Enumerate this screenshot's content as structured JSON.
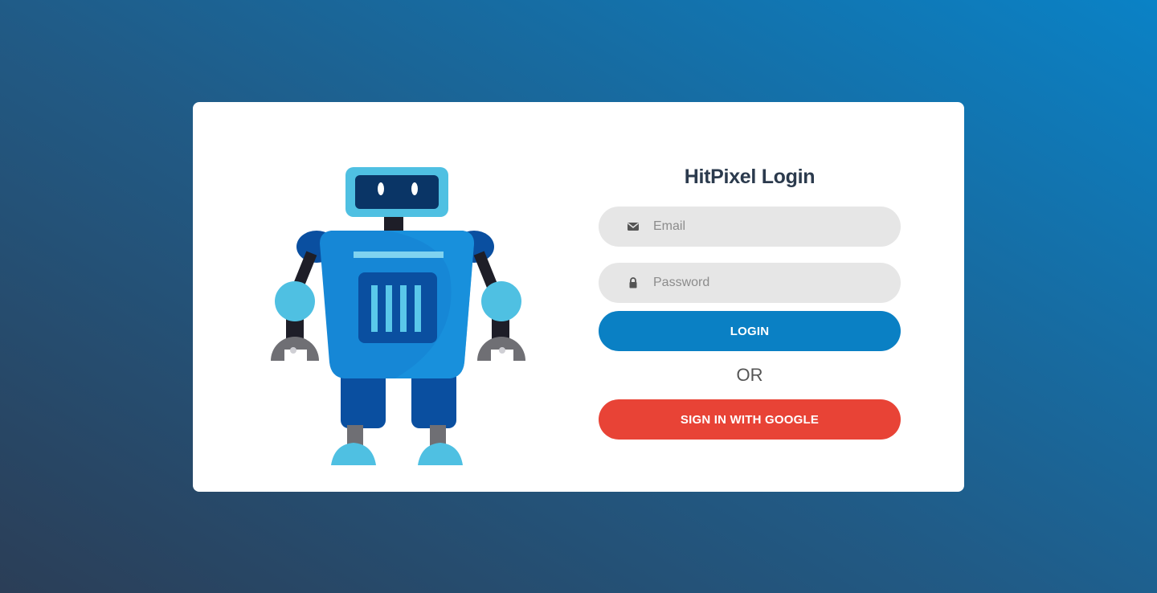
{
  "login": {
    "title": "HitPixel Login",
    "email": {
      "placeholder": "Email",
      "icon": "envelope-icon"
    },
    "password": {
      "placeholder": "Password",
      "icon": "lock-icon"
    },
    "login_label": "LOGIN",
    "or_label": "OR",
    "google_label": "SIGN IN WITH GOOGLE"
  },
  "colors": {
    "login_button": "#0a80c4",
    "google_button": "#e84336",
    "input_background": "#e6e6e6",
    "title_text": "#2b3a4d"
  },
  "illustration": {
    "icon": "robot-illustration"
  }
}
